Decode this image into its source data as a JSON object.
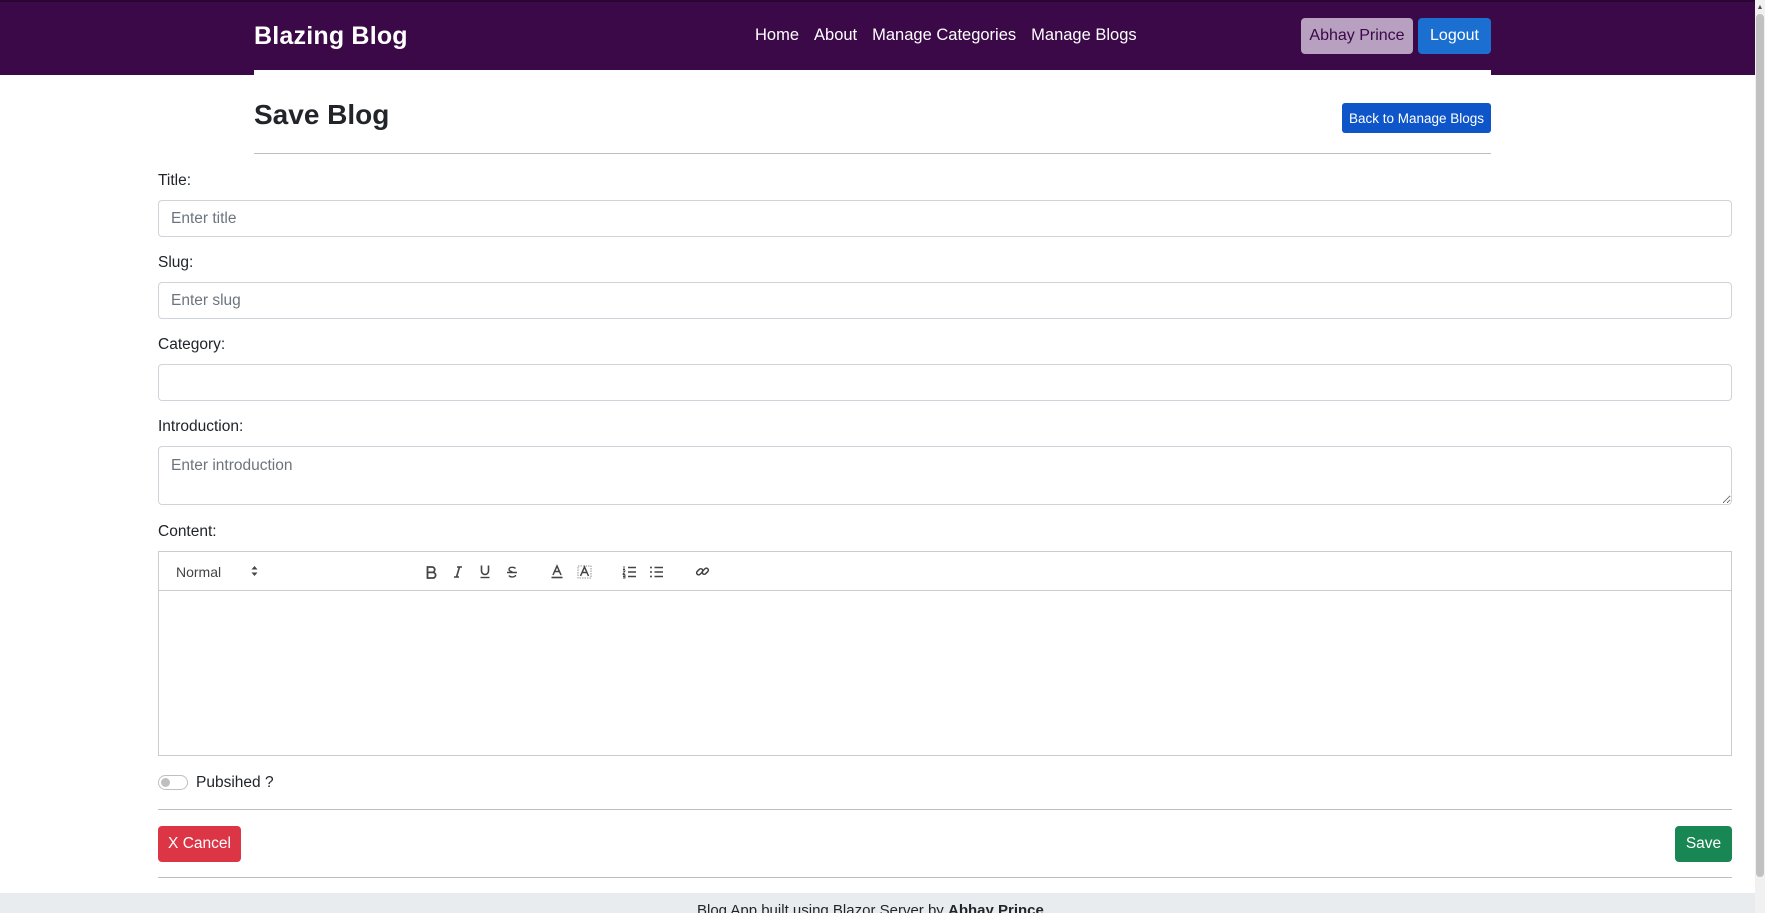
{
  "navbar": {
    "brand": "Blazing Blog",
    "links": [
      {
        "label": "Home"
      },
      {
        "label": "About"
      },
      {
        "label": "Manage Categories"
      },
      {
        "label": "Manage Blogs"
      }
    ],
    "user_name": "Abhay Prince",
    "logout_label": "Logout",
    "colors": {
      "background": "#3b0848",
      "logout": "#1a6fd1",
      "user": "#b8a0c0"
    }
  },
  "header": {
    "title": "Save Blog",
    "back_label": "Back to Manage Blogs"
  },
  "form": {
    "title": {
      "label": "Title:",
      "value": "",
      "placeholder": "Enter title"
    },
    "slug": {
      "label": "Slug:",
      "value": "",
      "placeholder": "Enter slug"
    },
    "category": {
      "label": "Category:",
      "value": ""
    },
    "introduction": {
      "label": "Introduction:",
      "value": "",
      "placeholder": "Enter introduction"
    },
    "content": {
      "label": "Content:",
      "toolbar": {
        "heading_value": "Normal",
        "icons": [
          "bold-icon",
          "italic-icon",
          "underline-icon",
          "strike-icon",
          "text-color-icon",
          "background-color-icon",
          "ordered-list-icon",
          "bullet-list-icon",
          "link-icon"
        ]
      },
      "value": ""
    },
    "published": {
      "label": "Pubsihed ?",
      "checked": false
    }
  },
  "actions": {
    "cancel_label": "X Cancel",
    "save_label": "Save",
    "colors": {
      "cancel": "#dc3545",
      "save": "#198754",
      "back": "#0d55c8"
    }
  },
  "footer": {
    "text": "Blog App built using Blazor Server by ",
    "author": "Abhay Prince"
  }
}
